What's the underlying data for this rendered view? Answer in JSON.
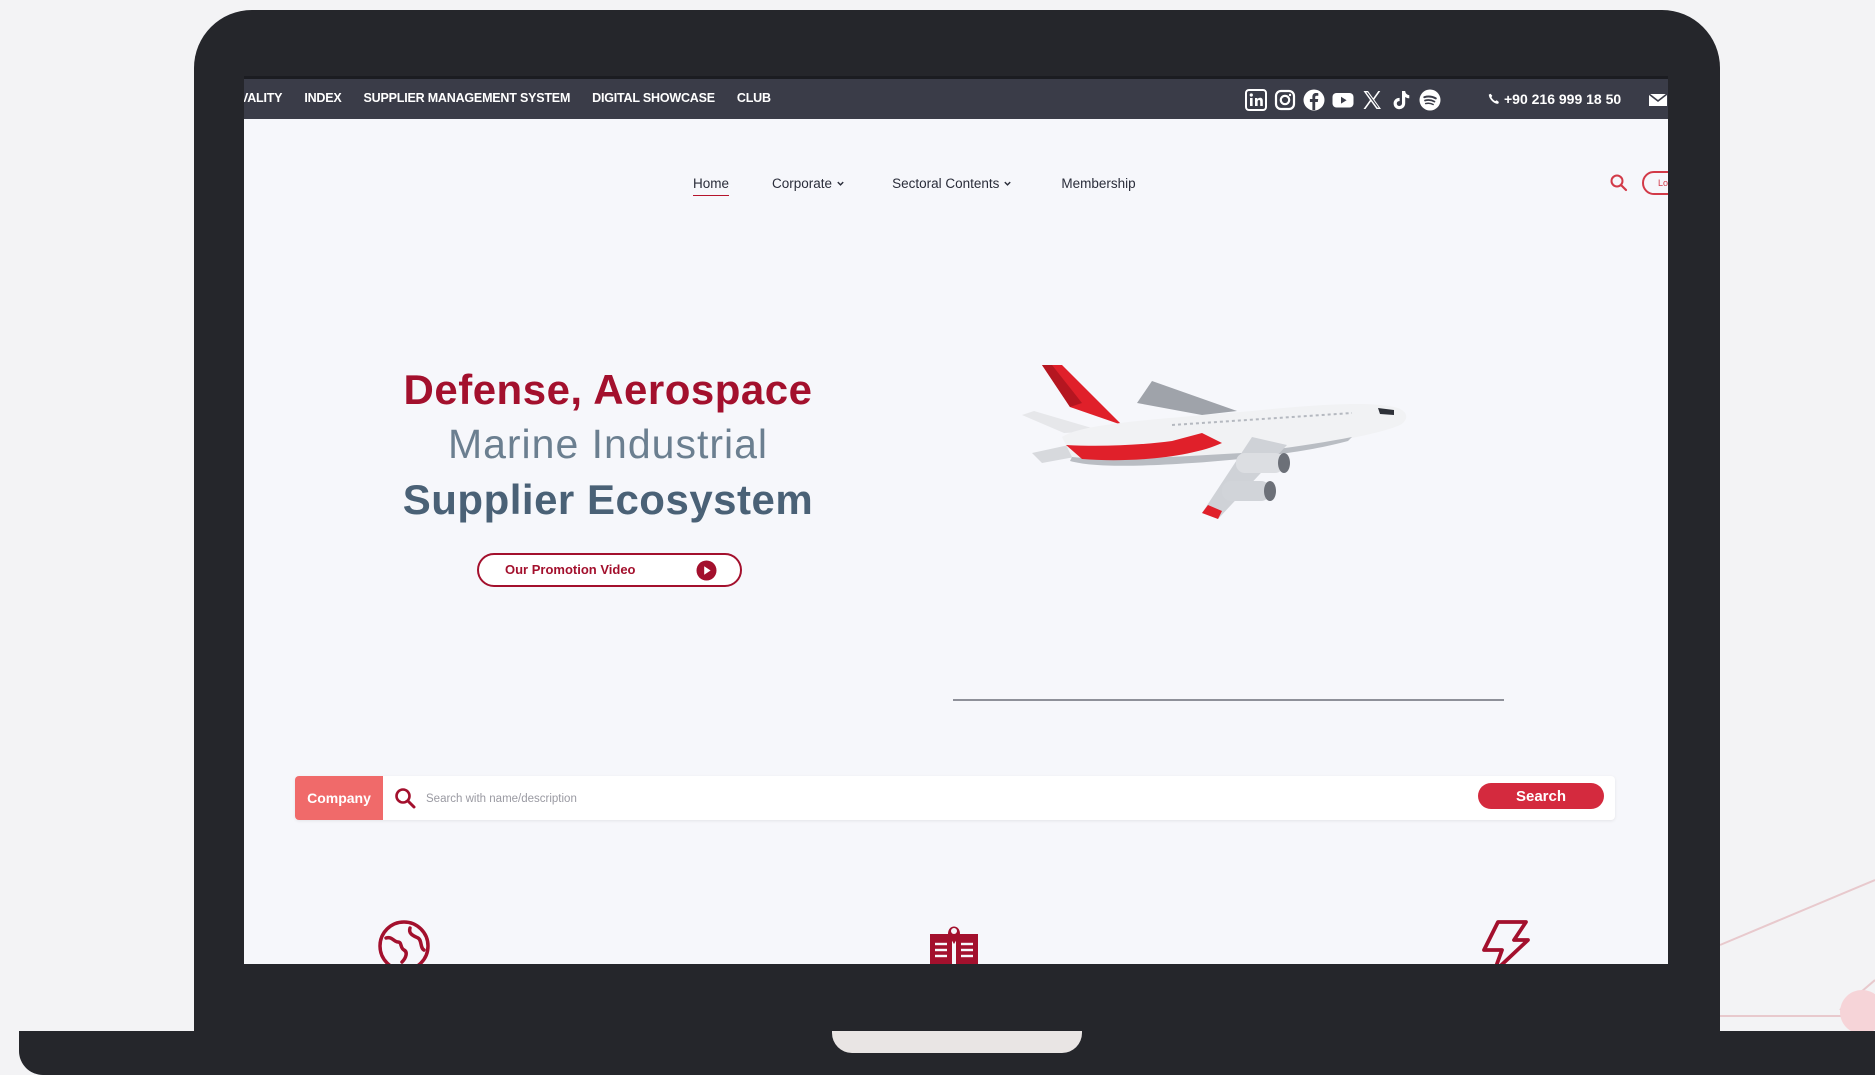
{
  "topbar": {
    "links": [
      "VALITY",
      "INDEX",
      "SUPPLIER MANAGEMENT SYSTEM",
      "DIGITAL SHOWCASE",
      "CLUB"
    ],
    "social": [
      "linkedin-icon",
      "instagram-icon",
      "facebook-icon",
      "youtube-icon",
      "x-icon",
      "tiktok-icon",
      "spotify-icon"
    ],
    "phone": "+90 216 999 18 50"
  },
  "nav": {
    "items": [
      "Home",
      "Corporate",
      "Sectoral Contents",
      "Membership"
    ],
    "login_partial": "Lo"
  },
  "hero": {
    "line1": "Defense, Aerospace",
    "line2": "Marine Industrial",
    "line3": "Supplier Ecosystem",
    "promo_label": "Our Promotion Video"
  },
  "search": {
    "tab_label": "Company",
    "placeholder": "Search with name/description",
    "button_label": "Search"
  },
  "features": {
    "icons": [
      "globe-icon",
      "book-icon",
      "lightning-icon"
    ]
  },
  "colors": {
    "brand_red": "#a3102d",
    "accent_red": "#d42a3e",
    "company_tab": "#f06a6a",
    "topbar_bg": "#3a3c48",
    "hero_gray": "#6b7f90",
    "hero_slate": "#4a6176",
    "device_frame": "#25262b"
  }
}
